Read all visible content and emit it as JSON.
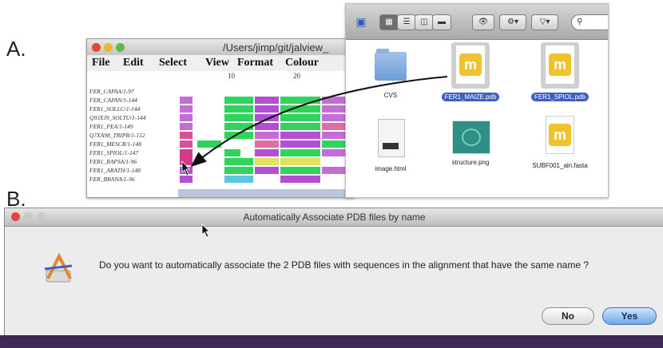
{
  "labels": {
    "a": "A.",
    "b": "B."
  },
  "jalview": {
    "title": "/Users/jimp/git/jalview_",
    "menus": [
      "File",
      "Edit",
      "Select",
      "View",
      "Format",
      "Colour"
    ],
    "ruler": [
      "10",
      "20"
    ],
    "sequences": [
      "FER_CAPAA/1-97",
      "FER_CAPAN/1-144",
      "FER1_SOLLC/1-144",
      "Q93XJ9_SOLTU/1-144",
      "FER1_PEA/1-149",
      "Q7XA98_TRIPR/1-152",
      "FER1_MESCR/1-148",
      "FER1_SPIOL/1-147",
      "FER1_RAPSA/1-96",
      "FER1_ARATH/1-148",
      "FER_BRANA/1-96"
    ]
  },
  "finder": {
    "files": [
      {
        "name": "CVS",
        "kind": "folder",
        "selected": false
      },
      {
        "name": "FER1_MAIZE.pdb",
        "kind": "pdb",
        "selected": true
      },
      {
        "name": "FER1_SPIOL.pdb",
        "kind": "pdb",
        "selected": true
      },
      {
        "name": "image.html",
        "kind": "html",
        "selected": false
      },
      {
        "name": "structure.png",
        "kind": "png",
        "selected": false
      },
      {
        "name": "SUBF001_aln.fasta",
        "kind": "fasta",
        "selected": false
      }
    ],
    "search_icon": "magnifier-icon"
  },
  "dialog": {
    "title": "Automatically Associate PDB files by name",
    "message": "Do you want to automatically associate the 2 PDB files with sequences in the alignment that have the same name ?",
    "no_label": "No",
    "yes_label": "Yes"
  },
  "colors": {
    "traffic_red": "#e0463c",
    "traffic_yellow": "#e9b92f",
    "traffic_green": "#5fb947",
    "selection_blue": "#3c5fc4",
    "clustal_green": "#2fd45a",
    "clustal_purple": "#b34fd1",
    "clustal_pink": "#e05cb0"
  }
}
